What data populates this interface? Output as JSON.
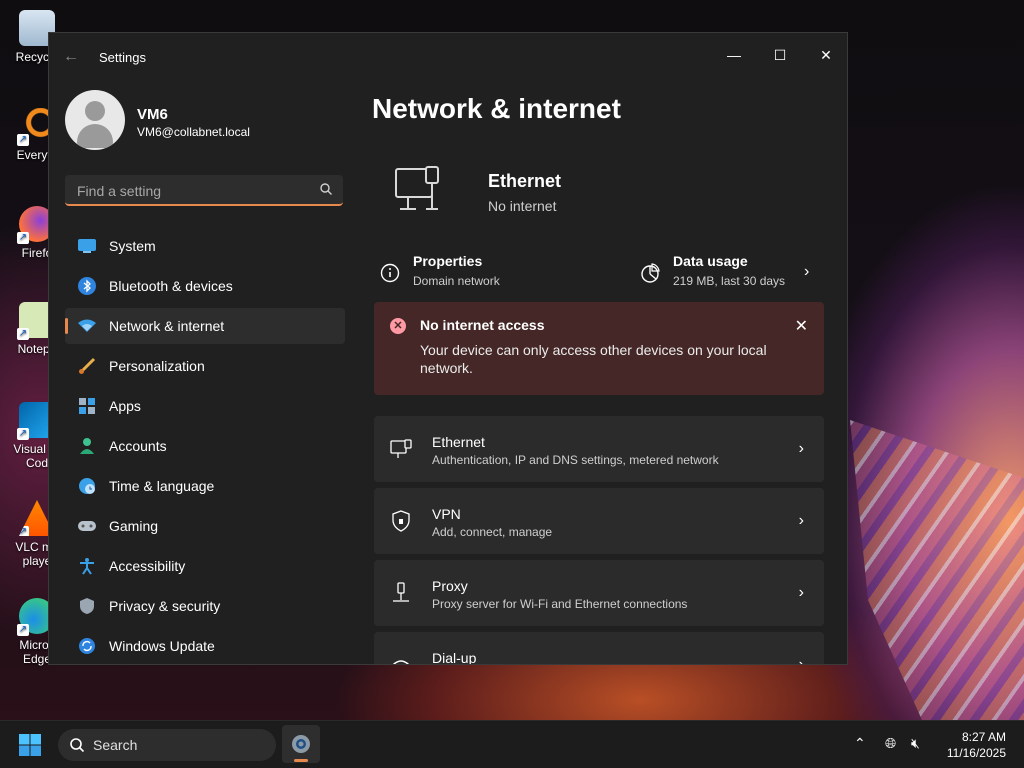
{
  "window": {
    "title": "Settings",
    "controls": {
      "minimize": "—",
      "maximize": "☐",
      "close": "✕"
    }
  },
  "profile": {
    "name": "VM6",
    "email": "VM6@collabnet.local"
  },
  "search": {
    "placeholder": "Find a setting"
  },
  "nav": [
    {
      "label": "System",
      "icon": "system-icon"
    },
    {
      "label": "Bluetooth & devices",
      "icon": "bluetooth-icon"
    },
    {
      "label": "Network & internet",
      "icon": "network-icon",
      "active": true
    },
    {
      "label": "Personalization",
      "icon": "brush-icon"
    },
    {
      "label": "Apps",
      "icon": "apps-icon"
    },
    {
      "label": "Accounts",
      "icon": "accounts-icon"
    },
    {
      "label": "Time & language",
      "icon": "globe-clock-icon"
    },
    {
      "label": "Gaming",
      "icon": "gamepad-icon"
    },
    {
      "label": "Accessibility",
      "icon": "accessibility-icon"
    },
    {
      "label": "Privacy & security",
      "icon": "shield-icon"
    },
    {
      "label": "Windows Update",
      "icon": "update-icon"
    }
  ],
  "main": {
    "page_title": "Network & internet",
    "connection": {
      "name": "Ethernet",
      "status": "No internet"
    },
    "properties": {
      "title": "Properties",
      "subtitle": "Domain network"
    },
    "data_usage": {
      "title": "Data usage",
      "subtitle": "219 MB, last 30 days"
    },
    "alert": {
      "title": "No internet access",
      "text": "Your device can only access other devices on your local network."
    },
    "cards": [
      {
        "title": "Ethernet",
        "subtitle": "Authentication, IP and DNS settings, metered network",
        "icon": "ethernet-icon"
      },
      {
        "title": "VPN",
        "subtitle": "Add, connect, manage",
        "icon": "vpn-shield-icon"
      },
      {
        "title": "Proxy",
        "subtitle": "Proxy server for Wi-Fi and Ethernet connections",
        "icon": "proxy-icon"
      },
      {
        "title": "Dial-up",
        "subtitle": "",
        "icon": "dialup-icon"
      }
    ]
  },
  "desktop": {
    "icons": [
      {
        "label": "Recycle"
      },
      {
        "label": "Everyth"
      },
      {
        "label": "Firefo"
      },
      {
        "label": "Notepa"
      },
      {
        "label": "Visual St Cod"
      },
      {
        "label": "VLC me playe"
      },
      {
        "label": "Micros Edge"
      }
    ]
  },
  "taskbar": {
    "search_label": "Search",
    "time": "8:27 AM",
    "date": "11/16/2025"
  },
  "colors": {
    "accent": "#e5894f",
    "window_bg": "#202020",
    "card_bg": "#2b2b2b",
    "alert_bg": "#442726",
    "alert_icon": "#ff99a4"
  }
}
